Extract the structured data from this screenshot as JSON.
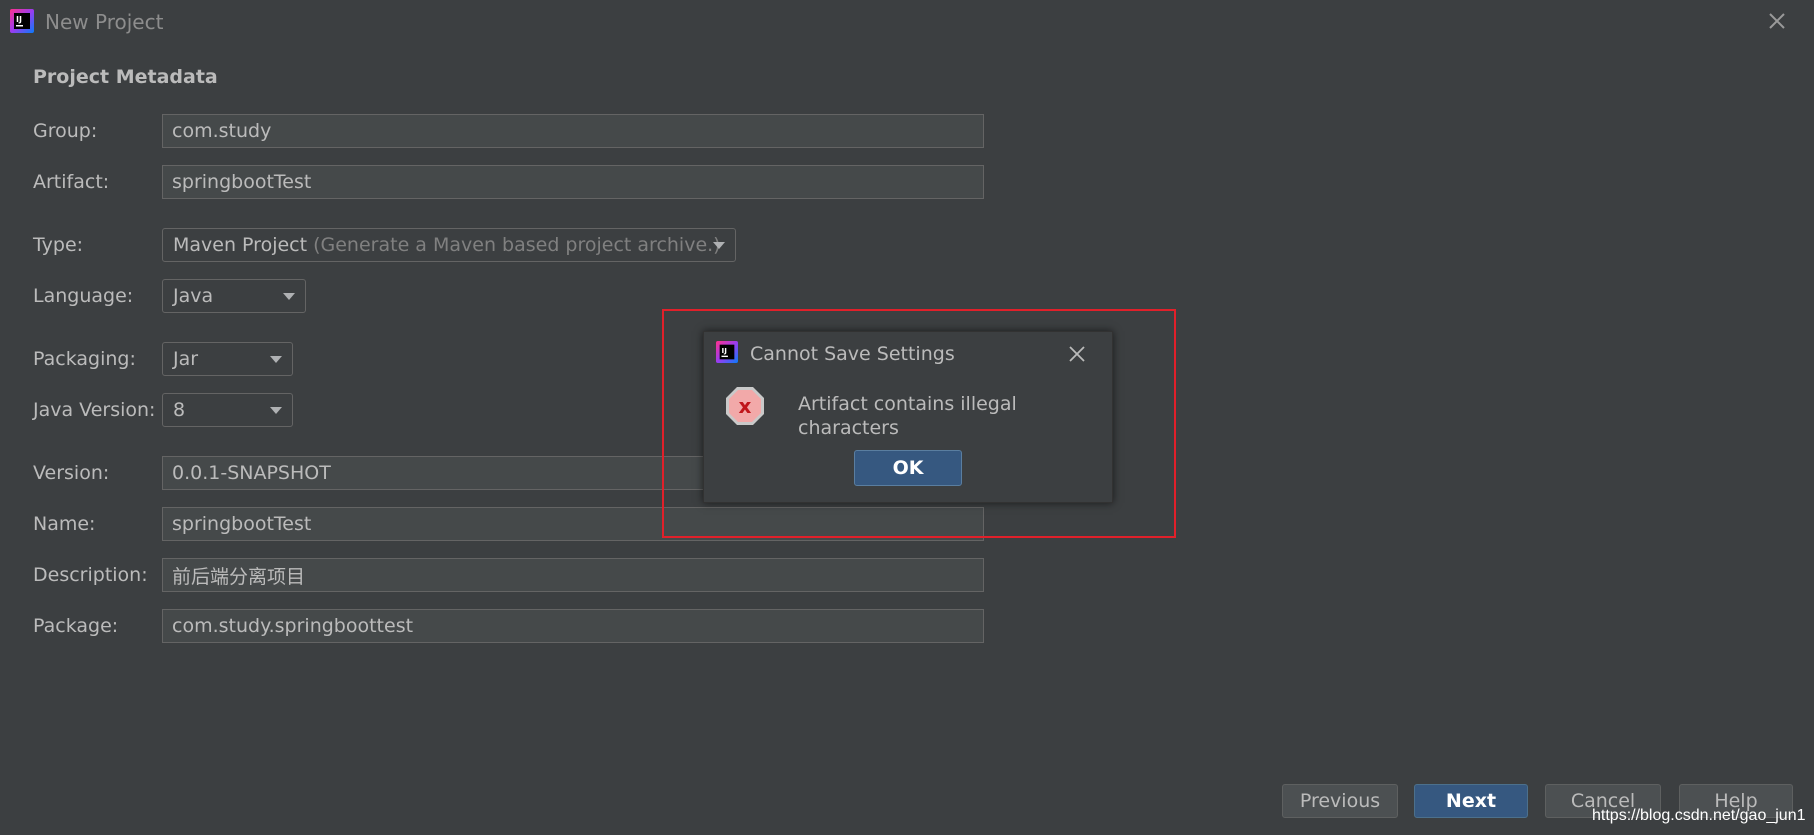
{
  "window": {
    "title": "New Project",
    "logo_text": "IJ"
  },
  "form": {
    "section_title": "Project Metadata",
    "group": {
      "label": "Group:",
      "value": "com.study"
    },
    "artifact": {
      "label": "Artifact:",
      "value": "springbootTest"
    },
    "type": {
      "label": "Type:",
      "value": "Maven Project",
      "hint": "(Generate a Maven based project archive.)"
    },
    "language": {
      "label": "Language:",
      "value": "Java"
    },
    "packaging": {
      "label": "Packaging:",
      "value": "Jar"
    },
    "java_version": {
      "label": "Java Version:",
      "value": "8"
    },
    "version": {
      "label": "Version:",
      "value": "0.0.1-SNAPSHOT"
    },
    "name": {
      "label": "Name:",
      "value": "springbootTest"
    },
    "description": {
      "label": "Description:",
      "value": "前后端分离项目"
    },
    "package": {
      "label": "Package:",
      "value": "com.study.springboottest"
    }
  },
  "buttons": {
    "previous": "Previous",
    "next": "Next",
    "cancel": "Cancel",
    "help": "Help"
  },
  "dialog": {
    "title": "Cannot Save Settings",
    "message": "Artifact contains illegal characters",
    "ok": "OK",
    "error_icon_glyph": "x"
  },
  "watermark": "https://blog.csdn.net/gao_jun1",
  "colors": {
    "background": "#3c3f41",
    "field_background": "#45494a",
    "primary_button": "#365880",
    "highlight_border": "#e1202a",
    "error_icon": "#d94b4b"
  }
}
